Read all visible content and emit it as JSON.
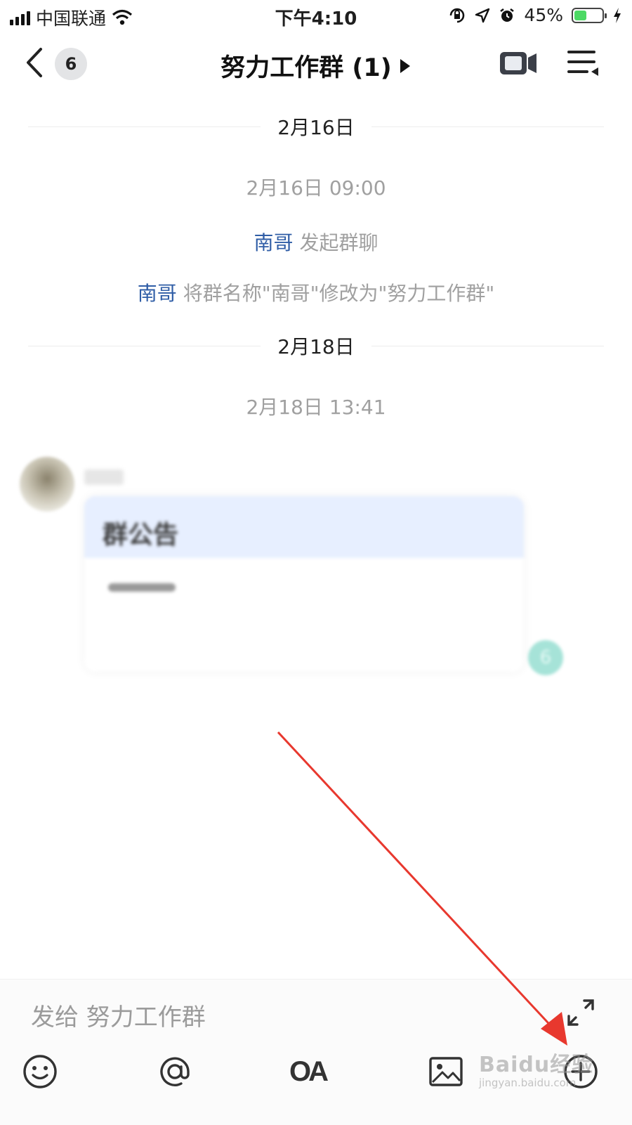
{
  "status_bar": {
    "carrier": "中国联通",
    "time": "下午4:10",
    "battery_percent": "45%",
    "battery_level": 0.45,
    "icons": [
      "signal-icon",
      "wifi-icon",
      "orientation-lock-icon",
      "location-icon",
      "alarm-icon",
      "battery-icon",
      "charging-icon"
    ]
  },
  "nav": {
    "unread_count": "6",
    "title": "努力工作群 (1)",
    "icons": [
      "back-icon",
      "play-triangle-icon",
      "video-call-icon",
      "menu-icon"
    ]
  },
  "chat": {
    "date_1": "2月16日",
    "time_1": "2月16日 09:00",
    "event_1_name": "南哥",
    "event_1_text": " 发起群聊",
    "event_2_name": "南哥",
    "event_2_text": " 将群名称\"南哥\"修改为\"努力工作群\"",
    "date_2": "2月18日",
    "time_2": "2月18日 13:41",
    "card_title": "群公告"
  },
  "input": {
    "placeholder": "发给 努力工作群"
  },
  "toolbar": {
    "items": [
      "emoji-icon",
      "at-icon",
      "oa-icon",
      "image-icon",
      "plus-icon"
    ],
    "oa_label": "OA"
  },
  "watermark": {
    "brand": "Baidu经验",
    "url": "jingyan.baidu.com"
  },
  "colors": {
    "name_link": "#2f5da6",
    "system_text": "#a0a0a0",
    "card_header": "#e7efff",
    "annotation_arrow": "#e8382e"
  }
}
